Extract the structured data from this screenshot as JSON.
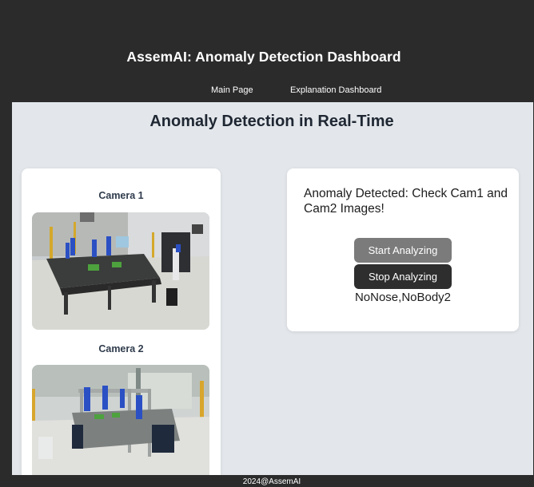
{
  "header": {
    "app_title": "AssemAI: Anomaly Detection Dashboard",
    "nav": [
      "Main Page",
      "Explanation Dashboard"
    ]
  },
  "main": {
    "page_title": "Anomaly Detection in Real-Time",
    "cameras": [
      {
        "label": "Camera 1"
      },
      {
        "label": "Camera 2"
      }
    ],
    "status": {
      "message": "Anomaly Detected: Check Cam1 and Cam2 Images!",
      "start_label": "Start Analyzing",
      "stop_label": "Stop Analyzing",
      "result": "NoNose,NoBody2"
    }
  },
  "footer": {
    "text": "2024@AssemAI"
  },
  "colors": {
    "header_bg": "#2b2b2b",
    "main_bg": "#e3e7eb",
    "card_bg": "#ffffff",
    "start_button": "#7b7b7b",
    "stop_button": "#2e2e2e"
  }
}
